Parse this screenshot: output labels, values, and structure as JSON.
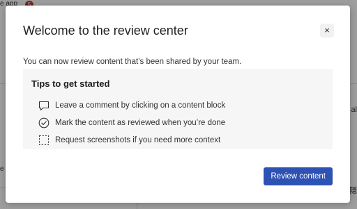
{
  "background": {
    "app_label": "e app",
    "badge": "5",
    "right_texts": [
      "al",
      "隠"
    ],
    "left_texts": [
      "e"
    ]
  },
  "modal": {
    "title": "Welcome to the review center",
    "close_label": "×",
    "description": "You can now review content that’s been shared by your team.",
    "tips": {
      "heading": "Tips to get started",
      "items": [
        {
          "icon": "comment-icon",
          "text": "Leave a comment by clicking on a content block"
        },
        {
          "icon": "check-circle-icon",
          "text": "Mark the content as reviewed when you’re done"
        },
        {
          "icon": "screenshot-icon",
          "text": "Request screenshots if you need more context"
        }
      ]
    },
    "primary_button_label": "Review content"
  },
  "colors": {
    "primary": "#2d52b4",
    "overlay": "rgba(0,0,0,0.38)",
    "tips_background": "#f6f6f6"
  }
}
